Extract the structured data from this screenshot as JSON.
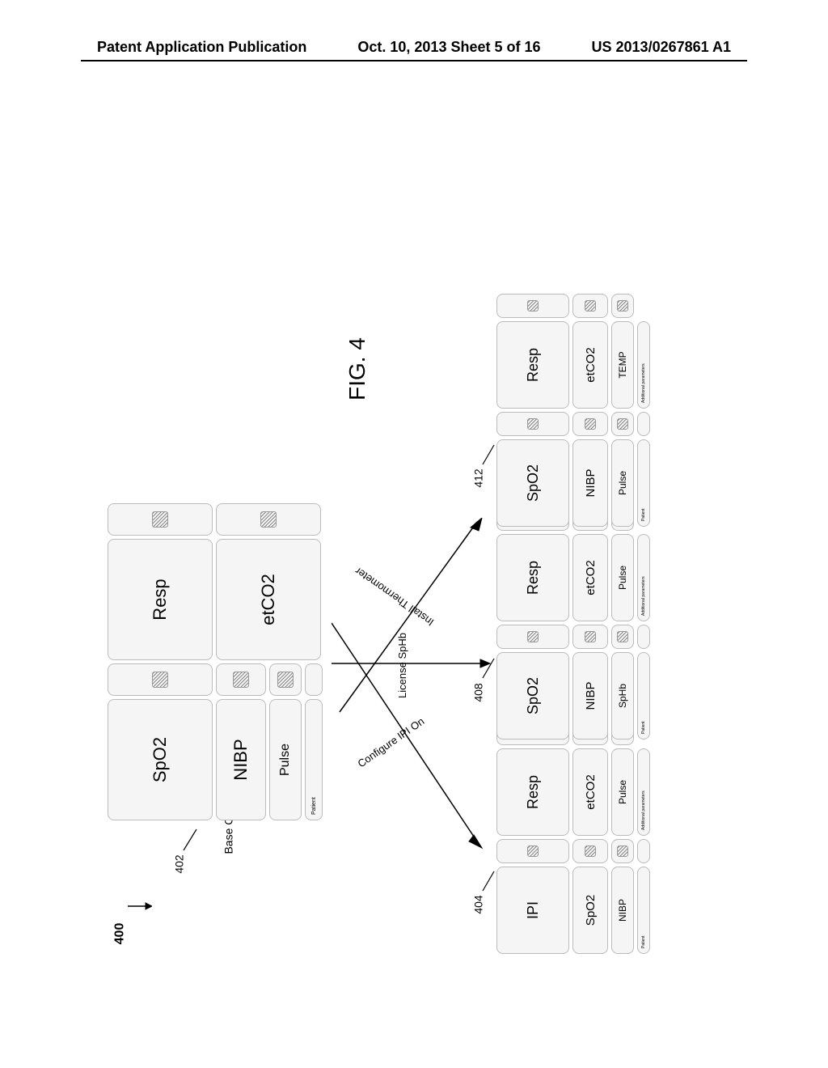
{
  "header": {
    "left": "Patent Application Publication",
    "center": "Oct. 10, 2013  Sheet 5 of 16",
    "right": "US 2013/0267861 A1"
  },
  "figure": {
    "number_label": "400",
    "caption": "FIG. 4",
    "base_config_label": "Base Configuration",
    "refs": {
      "base": "402",
      "ipi": "404",
      "sphb": "408",
      "thermo": "412"
    },
    "actions": {
      "ipi": "Configure IPI On",
      "sphb": "License SpHb",
      "thermo": "Install Thermometer"
    },
    "tiles": {
      "SpO2": "SpO2",
      "NIBP": "NIBP",
      "Pulse": "Pulse",
      "Resp": "Resp",
      "etCO2": "etCO2",
      "IPI": "IPI",
      "SpHb": "SpHb",
      "TEMP": "TEMP",
      "Patient": "Patient",
      "AdditionalParams": "Additional parameters"
    }
  }
}
